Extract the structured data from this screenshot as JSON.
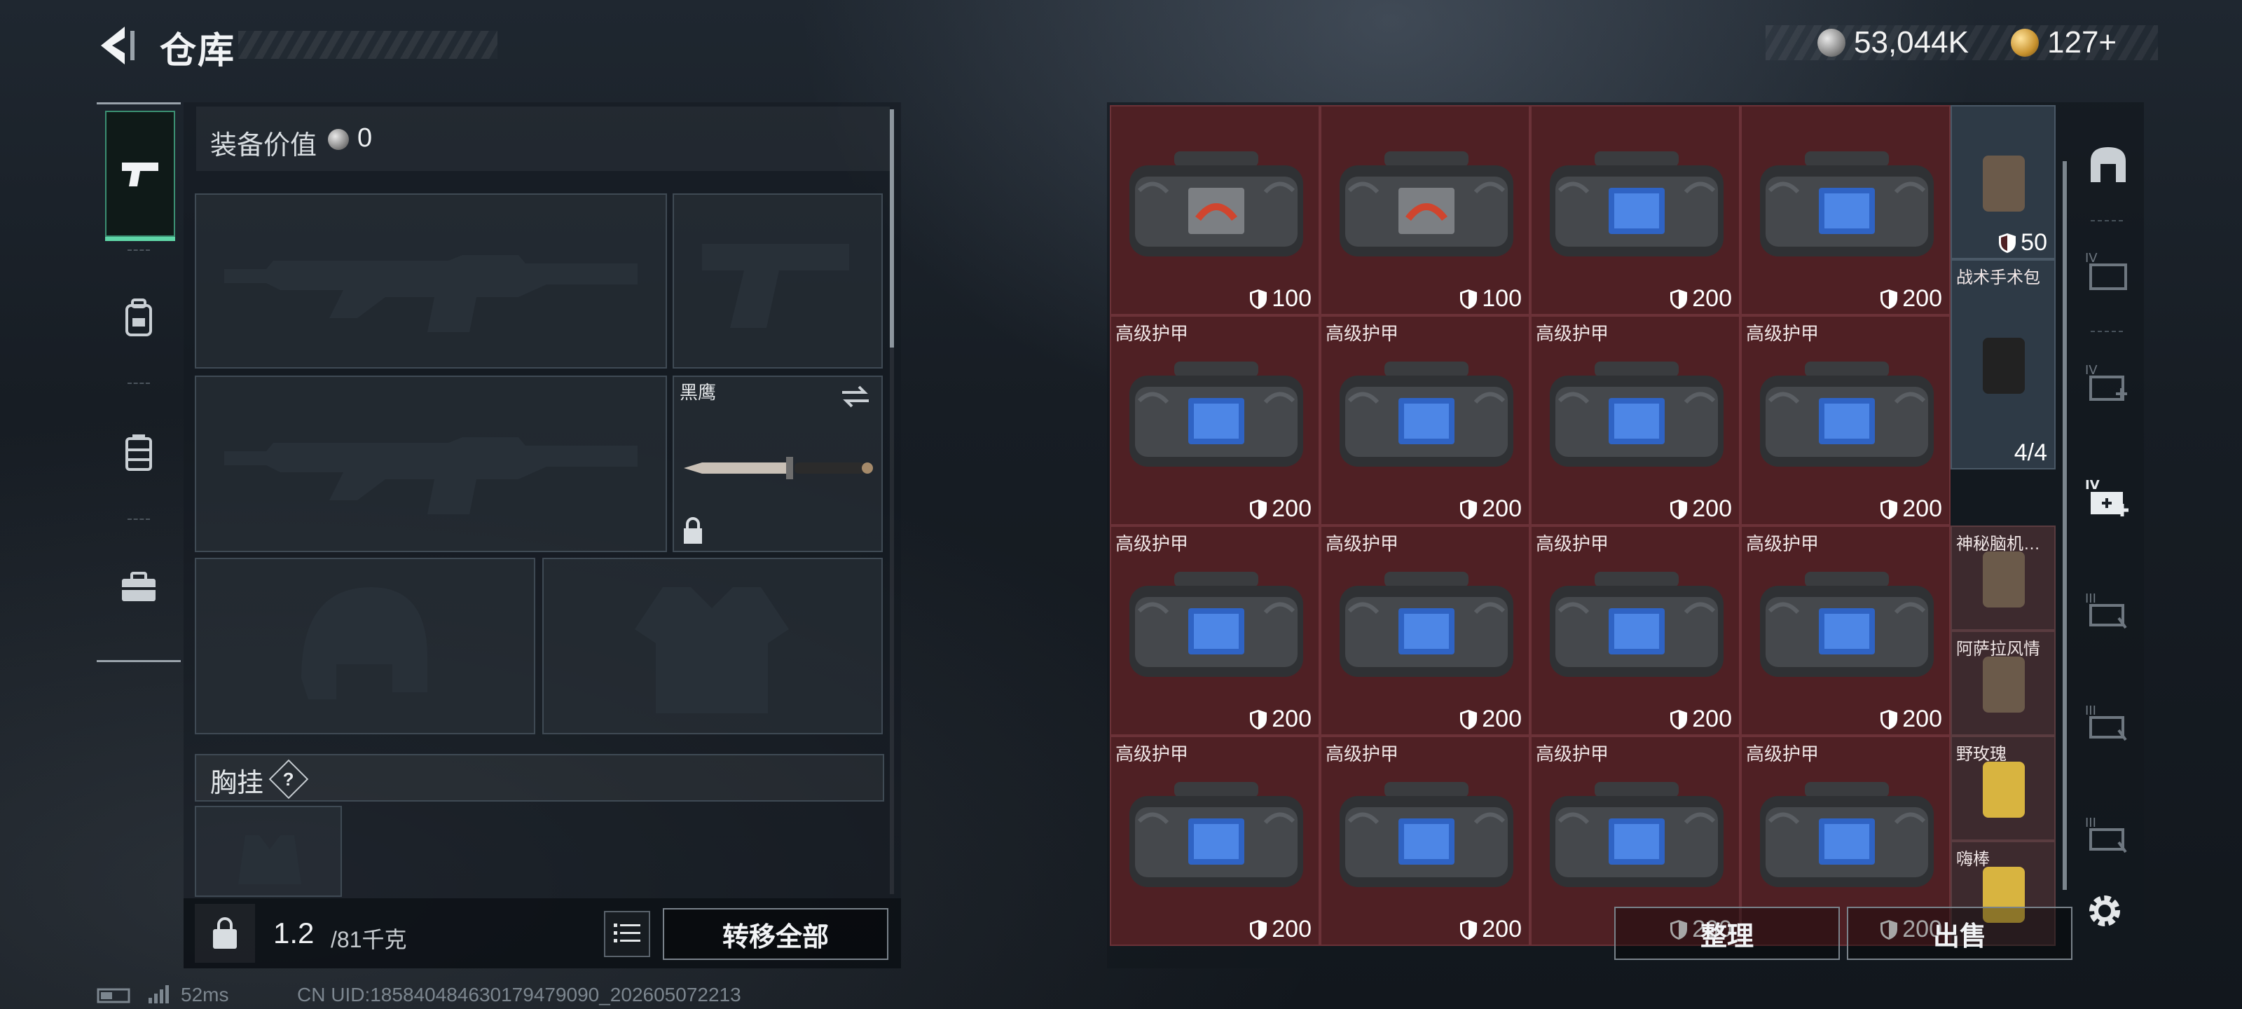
{
  "header": {
    "title": "仓库"
  },
  "currency": {
    "silver": "53,044K",
    "gold": "127+"
  },
  "equipment": {
    "label": "装备价值",
    "value": "0",
    "knife_name": "黑鹰",
    "rig_label": "胸挂",
    "rig_help": "?"
  },
  "weight": {
    "current": "1.2",
    "max": "/81千克"
  },
  "buttons": {
    "transfer_all": "转移全部",
    "sort": "整理",
    "sell": "出售"
  },
  "status": {
    "ping": "52ms",
    "uid": "CN UID:1858404846301794790​90_202605072213"
  },
  "grid": {
    "rows": [
      [
        {
          "name": "",
          "value": "100",
          "tag": "red"
        },
        {
          "name": "",
          "value": "100",
          "tag": "red"
        },
        {
          "name": "",
          "value": "200",
          "tag": "blue"
        },
        {
          "name": "",
          "value": "200",
          "tag": "blue"
        }
      ],
      [
        {
          "name": "高级护甲",
          "value": "200",
          "tag": "blue"
        },
        {
          "name": "高级护甲",
          "value": "200",
          "tag": "blue"
        },
        {
          "name": "高级护甲",
          "value": "200",
          "tag": "blue"
        },
        {
          "name": "高级护甲",
          "value": "200",
          "tag": "blue"
        }
      ],
      [
        {
          "name": "高级护甲",
          "value": "200",
          "tag": "blue"
        },
        {
          "name": "高级护甲",
          "value": "200",
          "tag": "blue"
        },
        {
          "name": "高级护甲",
          "value": "200",
          "tag": "blue"
        },
        {
          "name": "高级护甲",
          "value": "200",
          "tag": "blue"
        }
      ],
      [
        {
          "name": "高级护甲",
          "value": "200",
          "tag": "blue"
        },
        {
          "name": "高级护甲",
          "value": "200",
          "tag": "blue"
        },
        {
          "name": "高级护甲",
          "value": "200",
          "tag": "blue"
        },
        {
          "name": "高级护甲",
          "value": "200",
          "tag": "blue"
        }
      ]
    ],
    "side": [
      {
        "name": "",
        "value": "50"
      },
      {
        "name": "战术手术包",
        "value": "4/4"
      },
      {
        "name": "神秘脑机…",
        "value": ""
      },
      {
        "name": "阿萨拉风情",
        "value": ""
      },
      {
        "name": "野玫瑰",
        "value": ""
      },
      {
        "name": "嗨棒",
        "value": ""
      }
    ]
  },
  "tools": {
    "tiers": [
      "IV",
      "IV",
      "IV",
      "III",
      "III",
      "III"
    ]
  },
  "colors": {
    "accent": "#5fd6a7",
    "cell_red": "#4f2024"
  }
}
